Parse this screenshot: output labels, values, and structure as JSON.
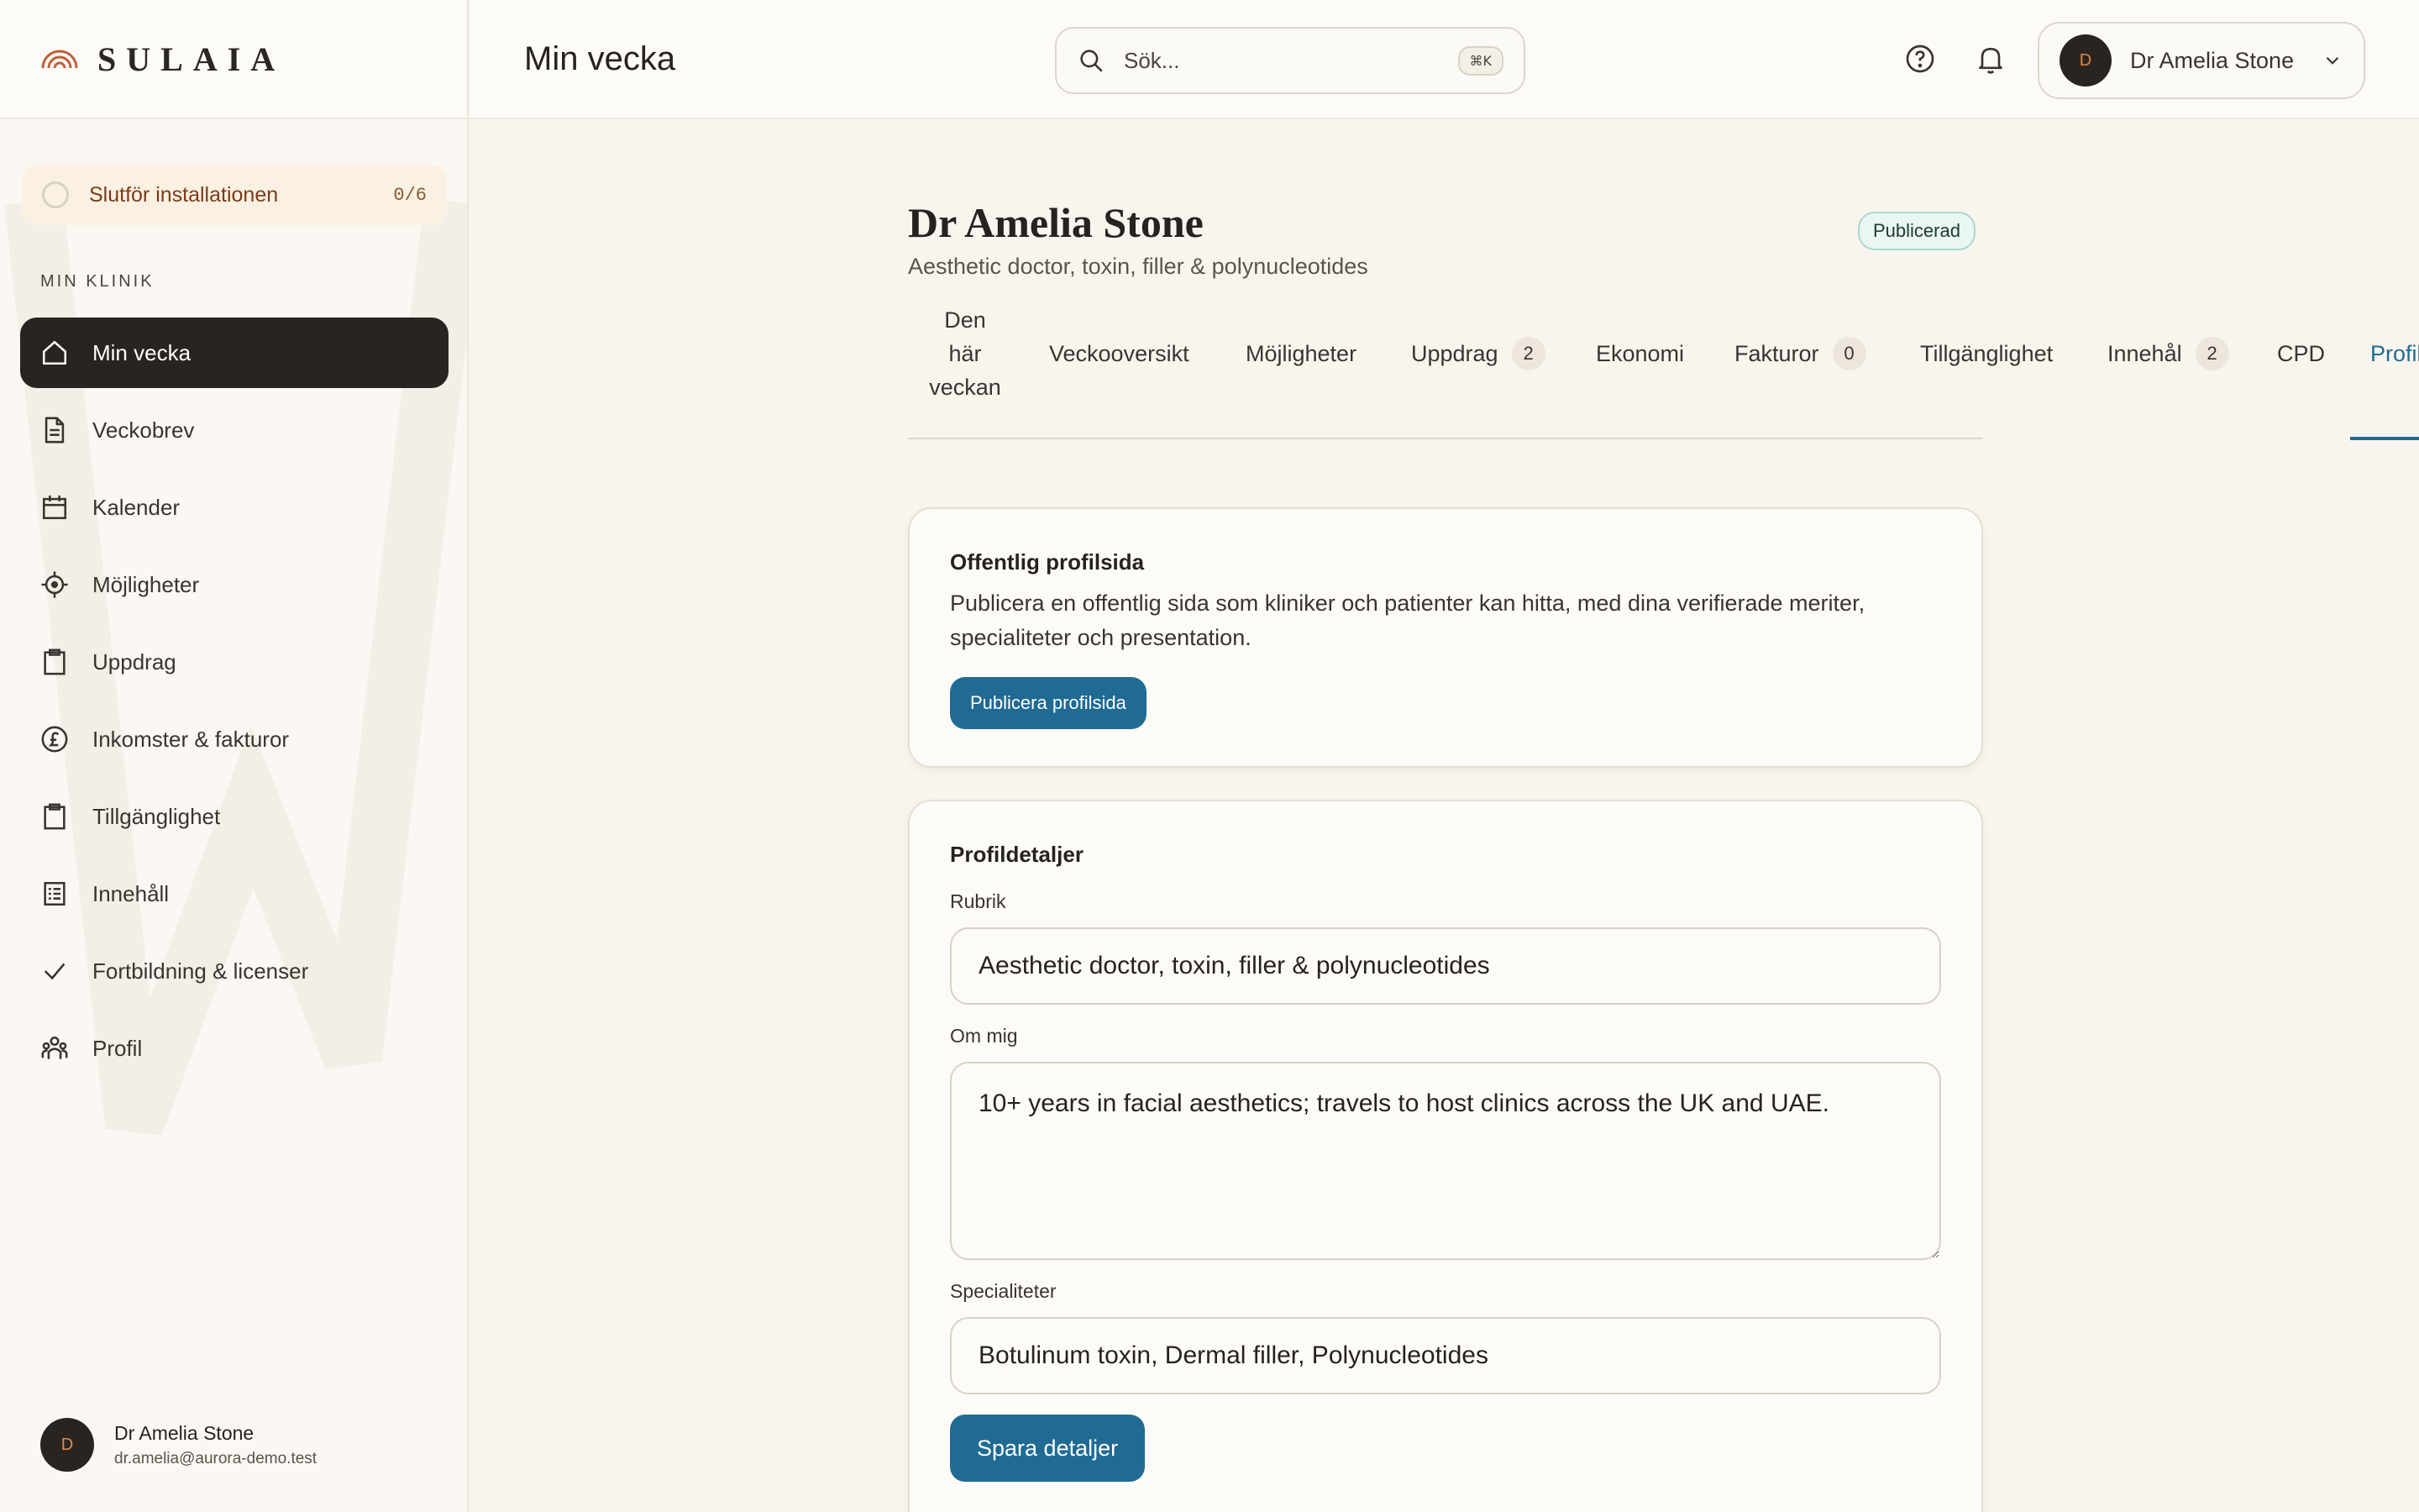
{
  "brand": {
    "name": "SULAIA"
  },
  "setup": {
    "label": "Slutför installationen",
    "count": "0/6"
  },
  "sidebar": {
    "section_title": "MIN KLINIK",
    "items": [
      {
        "label": "Min vecka",
        "icon": "home-icon",
        "active": true
      },
      {
        "label": "Veckobrev",
        "icon": "document-icon"
      },
      {
        "label": "Kalender",
        "icon": "calendar-icon"
      },
      {
        "label": "Möjligheter",
        "icon": "target-icon"
      },
      {
        "label": "Uppdrag",
        "icon": "clipboard-icon"
      },
      {
        "label": "Inkomster & fakturor",
        "icon": "pound-icon"
      },
      {
        "label": "Tillgänglighet",
        "icon": "clipboard-icon"
      },
      {
        "label": "Innehåll",
        "icon": "list-document-icon"
      },
      {
        "label": "Fortbildning & licenser",
        "icon": "check-icon"
      },
      {
        "label": "Profil",
        "icon": "people-icon"
      }
    ]
  },
  "user": {
    "initial": "D",
    "name": "Dr Amelia Stone",
    "email": "dr.amelia@aurora-demo.test"
  },
  "header": {
    "title": "Min vecka",
    "search_placeholder": "Sök...",
    "search_shortcut": "⌘K",
    "user_name": "Dr Amelia Stone"
  },
  "profile": {
    "name": "Dr Amelia Stone",
    "subtitle": "Aesthetic doctor, toxin, filler & polynucleotides",
    "status": "Publicerad"
  },
  "tabs": [
    {
      "label": "Den här veckan"
    },
    {
      "label": "Veckooversikt"
    },
    {
      "label": "Möjligheter"
    },
    {
      "label": "Uppdrag",
      "count": "2"
    },
    {
      "label": "Ekonomi"
    },
    {
      "label": "Fakturor",
      "count": "0"
    },
    {
      "label": "Tillgänglighet"
    },
    {
      "label": "Innehål",
      "count": "2"
    },
    {
      "label": "CPD"
    },
    {
      "label": "Profil",
      "active": true
    }
  ],
  "public_profile": {
    "title": "Offentlig profilsida",
    "description": "Publicera en offentlig sida som kliniker och patienter kan hitta, med dina verifierade meriter, specialiteter och presentation.",
    "button": "Publicera profilsida"
  },
  "details": {
    "title": "Profildetaljer",
    "headline_label": "Rubrik",
    "headline_value": "Aesthetic doctor, toxin, filler & polynucleotides",
    "about_label": "Om mig",
    "about_value": "10+ years in facial aesthetics; travels to host clinics across the UK and UAE.",
    "specialties_label": "Specialiteter",
    "specialties_value": "Botulinum toxin, Dermal filler, Polynucleotides",
    "save_button": "Spara detaljer"
  },
  "colors": {
    "accent": "#1f6b93",
    "sidebar_active": "#2a2420",
    "badge_border": "#a9d8cc"
  }
}
